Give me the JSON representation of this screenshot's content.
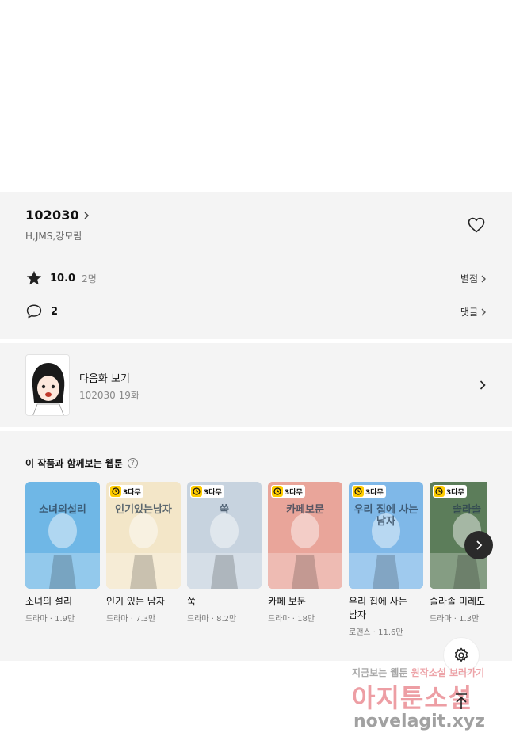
{
  "work": {
    "title": "102030",
    "authors": "H,JMS,강모림",
    "rating": "10.0",
    "rating_count": "2명",
    "rating_link": "별점",
    "comment_count": "2",
    "comment_link": "댓글"
  },
  "next_episode": {
    "label": "다음화 보기",
    "subtitle": "102030 19화"
  },
  "recommend": {
    "heading": "이 작품과 함께보는 웹툰",
    "help": "?",
    "items": [
      {
        "title": "소녀의 설리",
        "meta": "드라마 · 1.9만",
        "badge": "",
        "cover_text": "소녀의설리",
        "color": "#6fb7e6"
      },
      {
        "title": "인기 있는 남자",
        "meta": "드라마 · 7.3만",
        "badge": "3다무",
        "cover_text": "인기있는남자",
        "color": "#f3e6c8"
      },
      {
        "title": "쑥",
        "meta": "드라마 · 8.2만",
        "badge": "3다무",
        "cover_text": "쑥",
        "color": "#c7d3df"
      },
      {
        "title": "카페 보문",
        "meta": "드라마 · 18만",
        "badge": "3다무",
        "cover_text": "카페보문",
        "color": "#e9a59a"
      },
      {
        "title": "우리 집에 사는 남자",
        "meta": "로맨스 · 11.6만",
        "badge": "3다무",
        "cover_text": "우리 집에 사는 남자",
        "color": "#7fb8e8"
      },
      {
        "title": "솔라솔 미레도",
        "meta": "드라마 · 1.3만",
        "badge": "3다무",
        "cover_text": "솔라솔",
        "color": "#5c7d5a"
      }
    ]
  },
  "watermark": {
    "line1_a": "지금보는",
    "line1_b": "웹툰",
    "line1_c": "원작소설",
    "line1_d": "보러가기",
    "line2": "아지툰소설",
    "line3": "novelagit.xyz"
  }
}
